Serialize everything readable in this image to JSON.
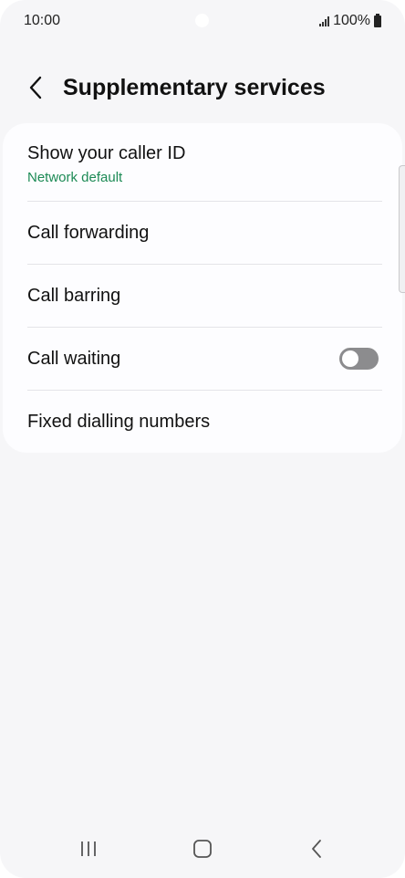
{
  "status_bar": {
    "time": "10:00",
    "battery": "100%"
  },
  "header": {
    "title": "Supplementary services"
  },
  "settings": [
    {
      "label": "Show your caller ID",
      "sub": "Network default"
    },
    {
      "label": "Call forwarding"
    },
    {
      "label": "Call barring"
    },
    {
      "label": "Call waiting",
      "toggle_on": false
    },
    {
      "label": "Fixed dialling numbers"
    }
  ],
  "colors": {
    "accent_green": "#1c8a55",
    "background": "#f6f6f8",
    "card": "#fdfdff",
    "toggle_off": "#8c8c8e"
  },
  "icons": {
    "back": "chevron-left-icon",
    "nav_recents": "recents-icon",
    "nav_home": "home-icon",
    "nav_back": "back-icon"
  }
}
